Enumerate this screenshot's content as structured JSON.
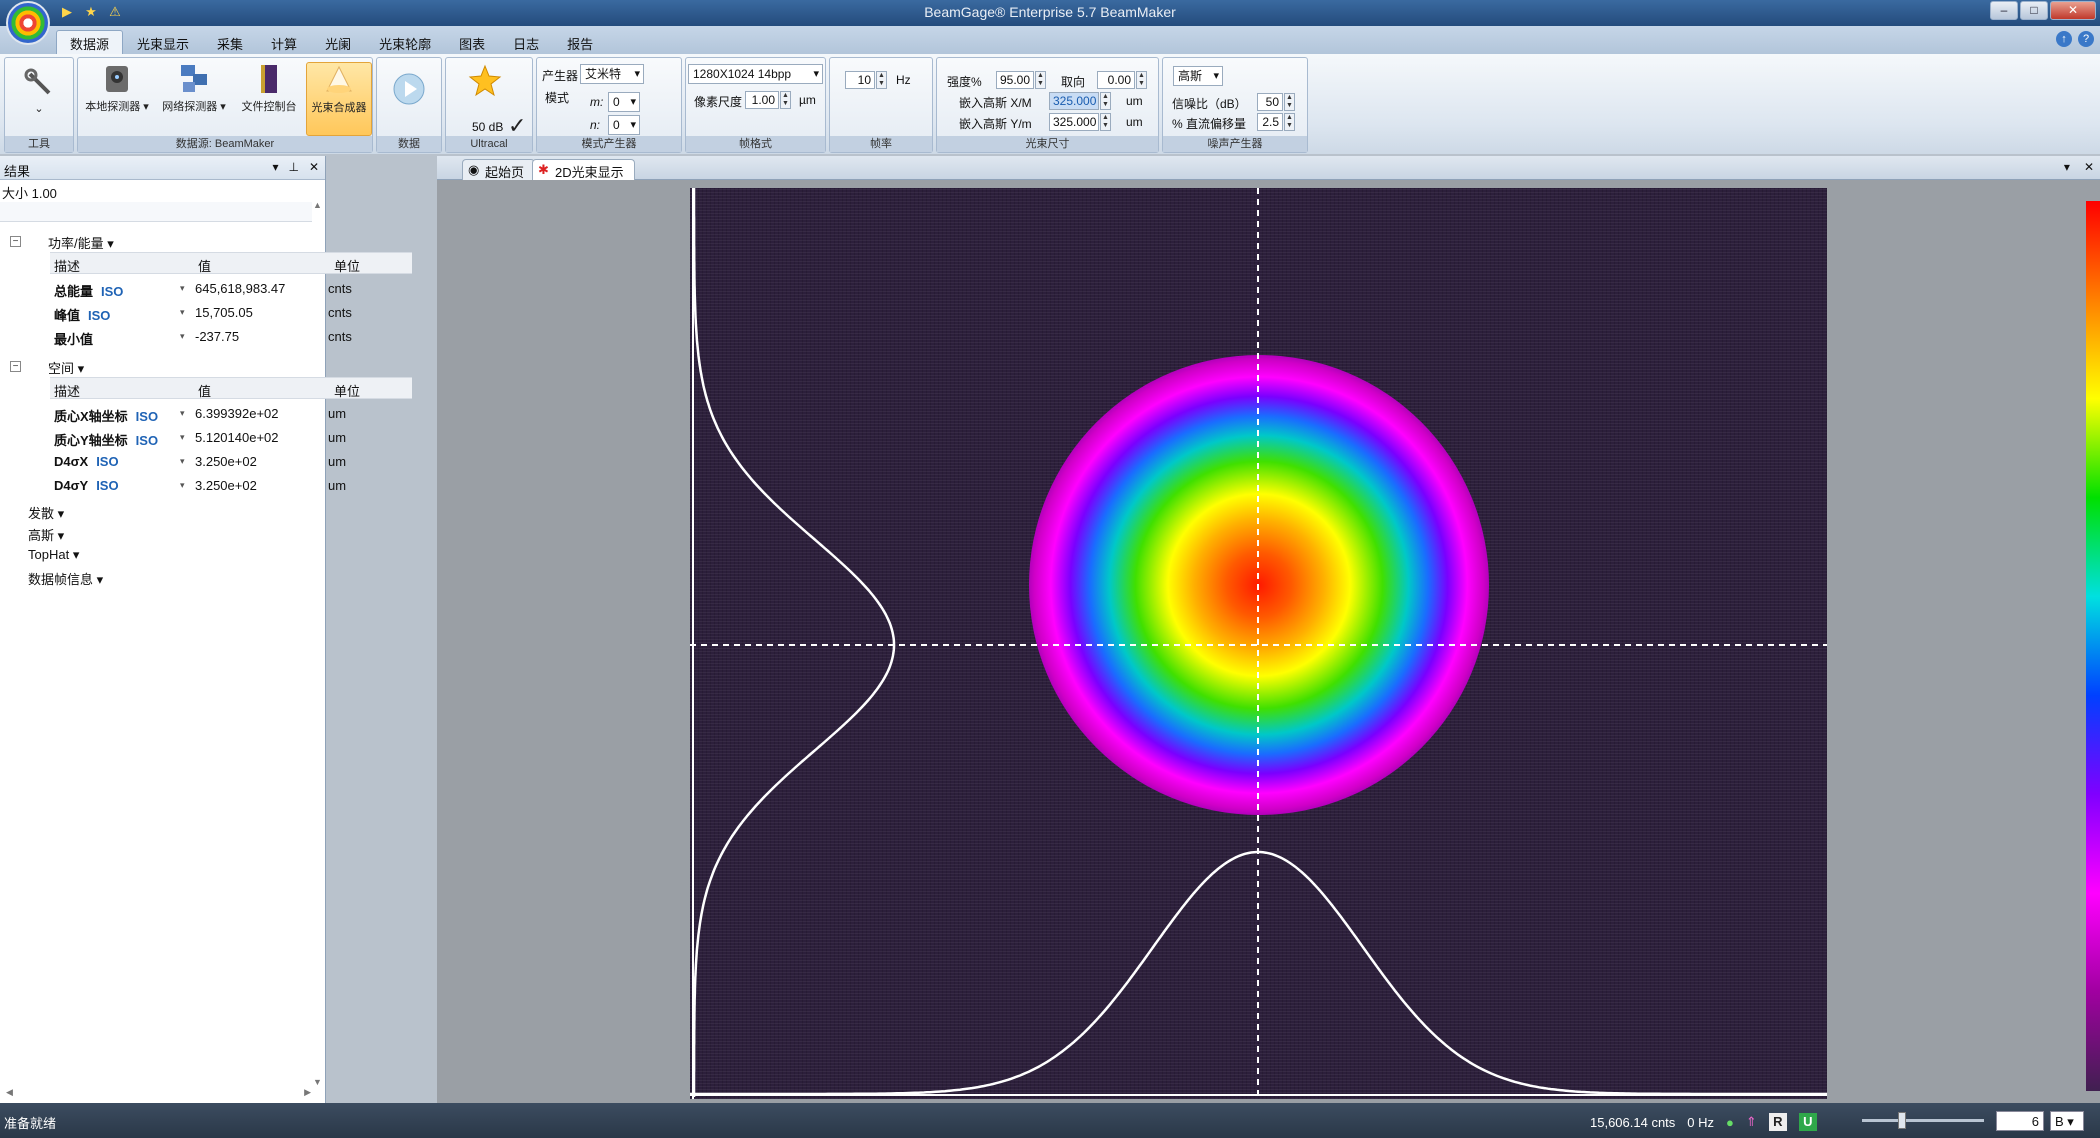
{
  "app": {
    "title": "BeamGage® Enterprise 5.7 BeamMaker"
  },
  "menus": [
    "数据源",
    "光束显示",
    "采集",
    "计算",
    "光阑",
    "光束轮廓",
    "图表",
    "日志",
    "报告"
  ],
  "ribbon": {
    "tools": {
      "label": "工具"
    },
    "source": {
      "label": "数据源: BeamMaker",
      "local": "本地探测器",
      "network": "网络探测器",
      "file": "文件控制台",
      "synth": "光束合成器"
    },
    "data": {
      "label": "数据"
    },
    "ultracal": {
      "label": "Ultracal",
      "db": "50 dB"
    },
    "mode": {
      "label": "模式产生器",
      "generator_lbl": "产生器",
      "generator_val": "艾米特",
      "mode_lbl": "模式",
      "m_lbl": "m:",
      "m_val": "0",
      "n_lbl": "n:",
      "n_val": "0"
    },
    "frame": {
      "label": "帧格式",
      "format": "1280X1024 14bpp",
      "pixel_lbl": "像素尺度",
      "pixel_val": "1.00",
      "pixel_unit": "µm"
    },
    "rate": {
      "label": "帧率",
      "value": "10",
      "unit": "Hz"
    },
    "beam": {
      "label": "光束尺寸",
      "intensity_lbl": "强度%",
      "intensity_val": "95.00",
      "orient_lbl": "取向",
      "orient_val": "0.00",
      "xm_lbl": "嵌入高斯 X/M",
      "xm_val": "325.000",
      "ym_lbl": "嵌入高斯 Y/m",
      "ym_val": "325.000",
      "unit": "um"
    },
    "noise": {
      "label": "噪声产生器",
      "type": "高斯",
      "snr_lbl": "信噪比（dB）",
      "snr_val": "50",
      "dc_lbl": "% 直流偏移量",
      "dc_val": "2.5"
    }
  },
  "results": {
    "title": "结果",
    "size": "大小 1.00",
    "power": {
      "title": "功率/能量",
      "cols": [
        "描述",
        "值",
        "单位"
      ],
      "rows": [
        {
          "desc": "总能量",
          "iso": "ISO",
          "val": "645,618,983.47",
          "unit": "cnts"
        },
        {
          "desc": "峰值",
          "iso": "ISO",
          "val": "15,705.05",
          "unit": "cnts"
        },
        {
          "desc": "最小值",
          "iso": "",
          "val": "-237.75",
          "unit": "cnts"
        }
      ]
    },
    "spatial": {
      "title": "空间",
      "cols": [
        "描述",
        "值",
        "单位"
      ],
      "rows": [
        {
          "desc": "质心X轴坐标",
          "iso": "ISO",
          "val": "6.399392e+02",
          "unit": "um"
        },
        {
          "desc": "质心Y轴坐标",
          "iso": "ISO",
          "val": "5.120140e+02",
          "unit": "um"
        },
        {
          "desc": "D4σX",
          "iso": "ISO",
          "val": "3.250e+02",
          "unit": "um"
        },
        {
          "desc": "D4σY",
          "iso": "ISO",
          "val": "3.250e+02",
          "unit": "um"
        }
      ]
    },
    "others": [
      "发散",
      "高斯",
      "TopHat",
      "数据帧信息"
    ]
  },
  "tabs": [
    "起始页",
    "2D光束显示"
  ],
  "status": {
    "ready": "准备就绪",
    "counts": "15,606.14 cnts",
    "rate": "0 Hz",
    "r": "R",
    "u": "U",
    "zoom": "6",
    "zoom_unit": "B"
  },
  "colors": {
    "accent": "#1f63b5",
    "beam_bg": "#2c1f3b",
    "ribbon_active": "#ffc75a"
  }
}
